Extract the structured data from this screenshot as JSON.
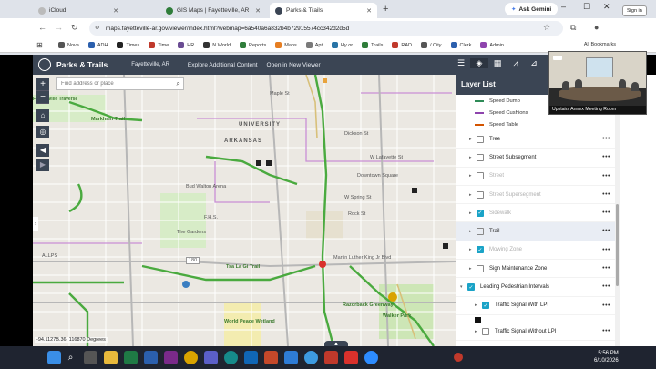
{
  "browser": {
    "tabs": [
      {
        "label": "iCloud",
        "active": false,
        "color": "#bbbbbb"
      },
      {
        "label": "GIS Maps | Fayetteville, AR - Official...",
        "active": false,
        "color": "#2f7d3a"
      },
      {
        "label": "Parks & Trails",
        "active": true,
        "color": "#3b4554"
      }
    ],
    "new_tab": "+",
    "gemini_label": "Ask Gemini",
    "url": "maps.fayetteville-ar.gov/viewer/index.html?webmap=6a540a6a832b4b72915574cc342d2d5d",
    "signin_label": "Sign in",
    "minimize": "–",
    "maximize": "☐",
    "close": "✕",
    "bookmarks": [
      {
        "label": "Nova",
        "color": "#555555"
      },
      {
        "label": "ADH",
        "color": "#2b5fad"
      },
      {
        "label": "Times",
        "color": "#222222"
      },
      {
        "label": "Time",
        "color": "#c0392b"
      },
      {
        "label": "HR",
        "color": "#6a4c93"
      },
      {
        "label": "N World",
        "color": "#333333"
      },
      {
        "label": "Reports",
        "color": "#2f7d3a"
      },
      {
        "label": "Maps",
        "color": "#e67e22"
      },
      {
        "label": "Apt",
        "color": "#7a7a7a"
      },
      {
        "label": "Hy or",
        "color": "#2874a6"
      },
      {
        "label": "Trails",
        "color": "#2f7d3a"
      },
      {
        "label": "RAD",
        "color": "#c0392b"
      },
      {
        "label": "/ City",
        "color": "#555555"
      },
      {
        "label": "Clerk",
        "color": "#2b5fad"
      },
      {
        "label": "Admin",
        "color": "#8e44ad"
      }
    ],
    "all_bookmarks": "All Bookmarks"
  },
  "app": {
    "title": "Parks & Trails",
    "subtitle": "Fayetteville, AR",
    "links": [
      "Explore Additional Content",
      "Open in New Viewer"
    ],
    "tools": [
      "list-icon",
      "layers-icon",
      "basemap-icon",
      "chart-icon",
      "measure-icon",
      "print-icon",
      "download-icon"
    ]
  },
  "map": {
    "search_placeholder": "Find address or place",
    "coords": "-94.1127B.36, 116870 Degrees",
    "labels": {
      "markham": "Markham Trail",
      "fayetteville_traverse": "Fayetteville Traverse",
      "university": "UNIVERSITY",
      "arkansas": "ARKANSAS",
      "dickson": "Dickson St",
      "spring": "W Spring St",
      "lafayette": "W Lafayette St",
      "mlk": "Martin Luther King Jr Blvd",
      "gardens": "The Gardens",
      "fhs": "F.H.S.",
      "tsa": "Tsa La Gi Trail",
      "downtown": "Downtown Square",
      "world_peace": "World Peace Wetland",
      "bud": "Bud Walton Arena",
      "razorback": "Razorback Greenway",
      "walker": "Walker Park",
      "hwy": "180",
      "allps": "ALLPS",
      "maple": "Maple St",
      "rock": "Rock St"
    }
  },
  "layer_list": {
    "title": "Layer List",
    "legend": [
      {
        "label": "Speed Dump",
        "color": "#2e8b57"
      },
      {
        "label": "Speed Cushions",
        "color": "#8e44ad"
      },
      {
        "label": "Speed Table",
        "color": "#d35400"
      }
    ],
    "rows": [
      {
        "label": "Tree",
        "checked": false,
        "dim": false,
        "kind": "layer"
      },
      {
        "label": "Street Subsegment",
        "checked": false,
        "dim": false,
        "kind": "layer"
      },
      {
        "label": "Street",
        "checked": false,
        "dim": true,
        "kind": "layer"
      },
      {
        "label": "Street Supersegment",
        "checked": false,
        "dim": true,
        "kind": "layer"
      },
      {
        "label": "Sidewalk",
        "checked": true,
        "dim": true,
        "kind": "layer"
      },
      {
        "label": "Trail",
        "checked": false,
        "dim": false,
        "kind": "layer",
        "highlight": true
      },
      {
        "label": "Mowing Zone",
        "checked": true,
        "dim": true,
        "kind": "layer"
      },
      {
        "label": "Sign Maintenance Zone",
        "checked": false,
        "dim": false,
        "kind": "layer"
      },
      {
        "label": "Leading Pedestrian Intervals",
        "checked": true,
        "dim": false,
        "kind": "group"
      },
      {
        "label": "Traffic Signal With LPI",
        "checked": true,
        "dim": false,
        "kind": "sub"
      },
      {
        "label": "Traffic Signal Without LPI",
        "checked": false,
        "dim": false,
        "kind": "sub"
      }
    ],
    "more": "•••"
  },
  "video": {
    "caption": "Upstairs Annex Meeting Room"
  },
  "taskbar": {
    "time": "5:56 PM",
    "date": "6/10/2026"
  }
}
